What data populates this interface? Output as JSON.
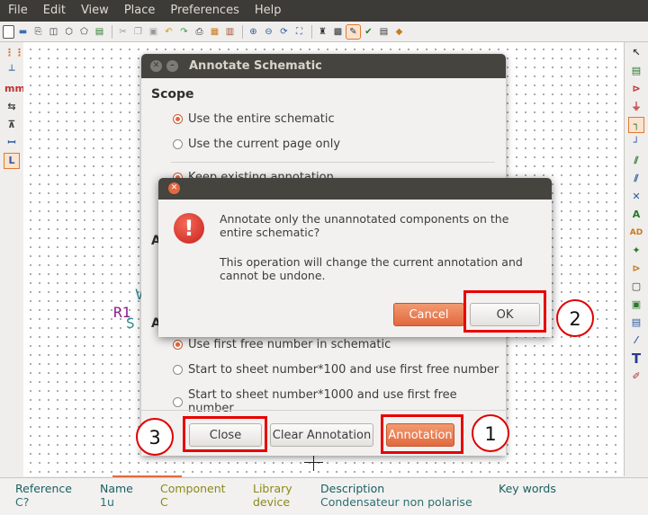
{
  "menu": [
    "File",
    "Edit",
    "View",
    "Place",
    "Preferences",
    "Help"
  ],
  "schematic": {
    "ref": "R1",
    "frag_s": "S",
    "frag_v": "V"
  },
  "annotate": {
    "title": "Annotate Schematic",
    "scope_heading": "Scope",
    "scope_options": [
      "Use the entire schematic",
      "Use the current page only"
    ],
    "hidden_option": "Keep existing annotation",
    "section_a1": "A",
    "section_a2": "A",
    "numbering_options": [
      "Use first free number in schematic",
      "Start to  sheet number*100 and use first free number",
      "Start to  sheet number*1000 and use first free number"
    ],
    "buttons": {
      "close": "Close",
      "clear": "Clear Annotation",
      "annotation": "Annotation"
    }
  },
  "confirm": {
    "message1": "Annotate only the unannotated components on the entire schematic?",
    "message2": "This operation will change the current annotation and cannot be undone.",
    "cancel": "Cancel",
    "ok": "OK"
  },
  "callouts": [
    "1",
    "2",
    "3"
  ],
  "status": {
    "reference_label": "Reference",
    "reference_value": "C?",
    "name_label": "Name",
    "name_value": "1u",
    "component_label": "Component",
    "component_value": "C",
    "library_label": "Library",
    "library_value": "device",
    "description_label": "Description",
    "description_value": "Condensateur non polarise",
    "keywords_label": "Key words"
  },
  "colors": {
    "accent": "#e2693f",
    "highlight": "#e80000",
    "titlebar": "#45443f"
  }
}
